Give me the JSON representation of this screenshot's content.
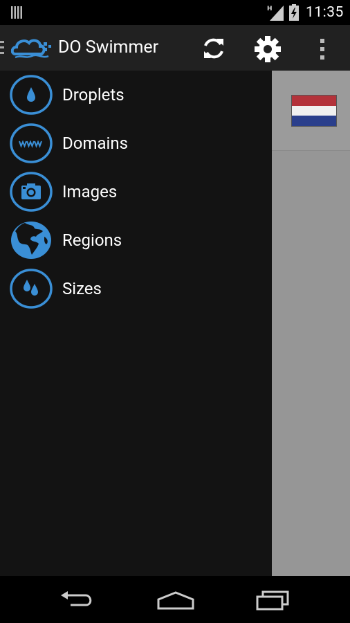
{
  "status_bar": {
    "time": "11:35",
    "network_type": "H",
    "icons": [
      "notification-icon",
      "signal-icon",
      "battery-icon"
    ]
  },
  "action_bar": {
    "title": "DO Swimmer",
    "icons": [
      "drawer-indicator-icon",
      "app-logo-icon",
      "refresh-icon",
      "settings-icon",
      "overflow-menu-icon"
    ]
  },
  "drawer": {
    "items": [
      {
        "label": "Droplets",
        "icon": "droplet-icon"
      },
      {
        "label": "Domains",
        "icon": "www-icon"
      },
      {
        "label": "Images",
        "icon": "camera-icon"
      },
      {
        "label": "Regions",
        "icon": "globe-icon"
      },
      {
        "label": "Sizes",
        "icon": "droplets-icon"
      }
    ]
  },
  "content": {
    "visible_items": [
      "netherlands-flag-icon"
    ]
  },
  "nav_bar": {
    "icons": [
      "back-icon",
      "home-icon",
      "recents-icon"
    ]
  },
  "colors": {
    "accent": "#3a8fd6",
    "drawer_bg": "#131313",
    "actionbar_bg": "#212121"
  }
}
